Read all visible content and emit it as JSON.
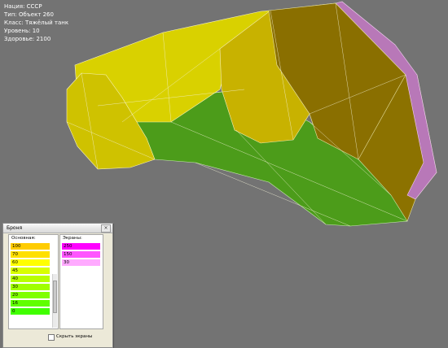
{
  "info": {
    "nation": "Нация: СССР",
    "type": "Тип: Объект 260",
    "class": "Класс: Тяжёлый танк",
    "level": "Уровень: 10",
    "health": "Здоровье: 2100"
  },
  "colors": {
    "background": "#737373",
    "hull_green": "#4c9c1a",
    "turret_olive": "#8c7200",
    "yellow_armor": "#d9d100",
    "screen_pink": "#b878b8"
  },
  "armor_window": {
    "title": "Броня",
    "close_label": "×",
    "base_header": "Основная:",
    "screen_header": "Экраны:",
    "base_rows": [
      {
        "label": "100",
        "color": "#ffcc00"
      },
      {
        "label": "70",
        "color": "#ffe000"
      },
      {
        "label": "60",
        "color": "#ffff00"
      },
      {
        "label": "45",
        "color": "#d8ff00"
      },
      {
        "label": "40",
        "color": "#b8ff00"
      },
      {
        "label": "30",
        "color": "#a0ff00"
      },
      {
        "label": "20",
        "color": "#80ff00"
      },
      {
        "label": "16",
        "color": "#60ff00"
      },
      {
        "label": "0",
        "color": "#40ff00"
      }
    ],
    "screen_rows": [
      {
        "label": "250",
        "color": "#ff00ff"
      },
      {
        "label": "150",
        "color": "#ff55ff"
      },
      {
        "label": "30",
        "color": "#ffaaff"
      }
    ],
    "hide_screens_label": "Скрыть экраны"
  }
}
